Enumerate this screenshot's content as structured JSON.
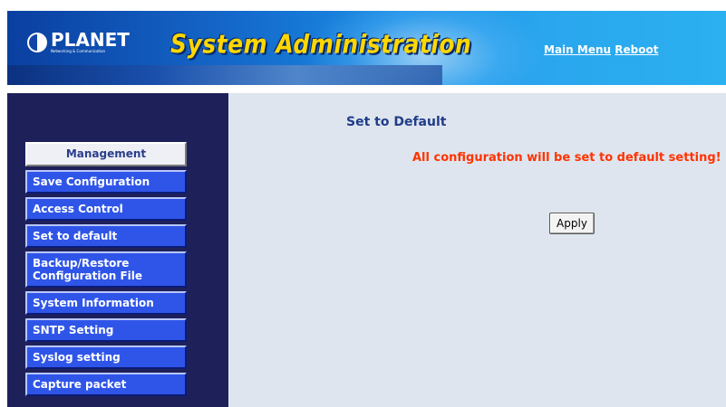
{
  "header": {
    "brand": "PLANET",
    "brand_tagline": "Networking & Communication",
    "title": "System Administration",
    "links": [
      {
        "label": "Main Menu"
      },
      {
        "label": "Reboot"
      }
    ]
  },
  "sidebar": {
    "section_title": "Management",
    "items": [
      {
        "label": "Save Configuration"
      },
      {
        "label": "Access Control"
      },
      {
        "label": "Set to default"
      },
      {
        "label": "Backup/Restore Configuration File"
      },
      {
        "label": "System Information"
      },
      {
        "label": "SNTP Setting"
      },
      {
        "label": "Syslog setting"
      },
      {
        "label": "Capture packet"
      }
    ]
  },
  "main": {
    "title": "Set to Default",
    "warning": "All   configuration will be set to default setting!",
    "apply_label": "Apply"
  },
  "colors": {
    "sidebar_bg": "#1e2159",
    "menu_item_bg": "#2f55e8",
    "content_bg": "#dfe5ee",
    "title_color": "#1f3d8a",
    "warning_color": "#ff3300",
    "header_title_color": "#ffd700"
  }
}
